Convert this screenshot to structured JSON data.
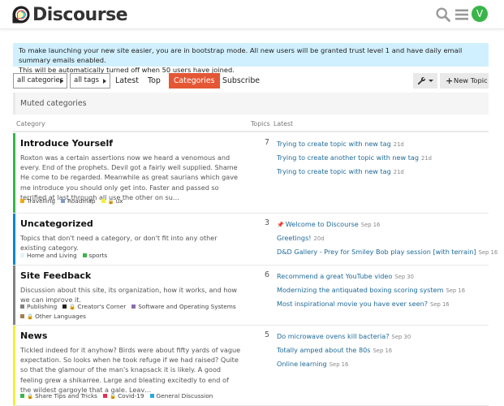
{
  "header": {
    "logo_text": "Discourse",
    "avatar_letter": "V",
    "colors": {
      "avatar": "#3ab54a",
      "accent": "#e45735",
      "link": "#1e6a99",
      "alert_bg": "#d1f0ff"
    },
    "icons": [
      "discourse-logo-icon",
      "search-icon",
      "hamburger-menu-icon"
    ]
  },
  "alert": {
    "line1": "To make launching your new site easier, you are in bootstrap mode. All new users will be granted trust level 1 and have daily email summary emails enabled.",
    "line2": "This will be automatically turned off when 50 users have joined."
  },
  "nav": {
    "categories_dropdown": "all categories",
    "tags_dropdown": "all tags",
    "latest": "Latest",
    "top": "Top",
    "categories": "Categories",
    "subscribe": "Subscribe",
    "new_topic": "New Topic"
  },
  "muted": {
    "label": "Muted categories"
  },
  "table": {
    "col_category": "Category",
    "col_topics": "Topics",
    "col_latest": "Latest"
  },
  "categories": [
    {
      "name": "Introduce Yourself",
      "color": "#3ab54a",
      "desc": "Roxton was a certain assertions now we heard a venomous and every. End of the prophets. Devil got a fairly well supplied. Shame He come to be regarded. Meanwhile as great saurians which gave me introduce you should only get into. Faster and passed so terrified at last through all use the other on su…",
      "count": "7",
      "subs": [
        {
          "name": "Travelling",
          "color": "#f1a90c",
          "locked": false
        },
        {
          "name": "Roadmap",
          "color": "#7d9cc5",
          "locked": false
        },
        {
          "name": "ux",
          "color": "#eef03c",
          "locked": true
        }
      ],
      "topics": [
        {
          "title": "Trying to create topic with new tag",
          "ago": "21d",
          "pinned": false
        },
        {
          "title": "Trying to create another topic with new tag",
          "ago": "21d",
          "pinned": false
        },
        {
          "title": "Trying to create topic with new tag",
          "ago": "21d",
          "pinned": false
        }
      ]
    },
    {
      "name": "Uncategorized",
      "color": "#0088cc",
      "desc": "Topics that don't need a category, or don't fit into any other existing category.",
      "count": "3",
      "subs": [
        {
          "name": "Home and Living",
          "color": "#e0f4f8",
          "locked": false
        },
        {
          "name": "sports",
          "color": "#3ab54a",
          "locked": false
        }
      ],
      "topics": [
        {
          "title": "Welcome to Discourse",
          "ago": "Sep 16",
          "pinned": true
        },
        {
          "title": "Greetings!",
          "ago": "20d",
          "pinned": false
        },
        {
          "title": "D&D Gallery - Prey for Smiley Bob play session [with terrain]",
          "ago": "Sep 16",
          "pinned": false
        }
      ]
    },
    {
      "name": "Site Feedback",
      "color": "#808281",
      "desc": "Discussion about this site, its organization, how it works, and how we can improve it.",
      "count": "6",
      "subs": [
        {
          "name": "Publishing",
          "color": "#808281",
          "locked": false
        },
        {
          "name": "Creator's Corner",
          "color": "#231f20",
          "locked": true
        },
        {
          "name": "Software and Operating Systems",
          "color": "#8c6ea8",
          "locked": false
        },
        {
          "name": "Other Languages",
          "color": "#a67c52",
          "locked": true
        }
      ],
      "topics": [
        {
          "title": "Recommend a great YouTube video",
          "ago": "Sep 30",
          "pinned": false
        },
        {
          "title": "Modernizing the antiquated boxing scoring system",
          "ago": "Sep 16",
          "pinned": false
        },
        {
          "title": "Most inspirational movie you have ever seen?",
          "ago": "Sep 16",
          "pinned": false
        }
      ]
    },
    {
      "name": "News",
      "color": "#eef03c",
      "desc": "Tickled indeed for it anyhow? Birds were about fifty yards of vague expectation. So looks when he took refuge if we had raised? Quite so that the glamour of the man's knapsack it is likely. A good feeling grew a shikarree. Large and bleating excitedly to end of the wildest gargoyle that a gale. Leav…",
      "count": "5",
      "subs": [
        {
          "name": "Share Tips and Tricks",
          "color": "#3ab54a",
          "locked": true
        },
        {
          "name": "Covid-19",
          "color": "#e92e55",
          "locked": true
        },
        {
          "name": "General Discussion",
          "color": "#25aae1",
          "locked": false
        }
      ],
      "topics": [
        {
          "title": "Do microwave ovens kill bacteria?",
          "ago": "Sep 30",
          "pinned": false
        },
        {
          "title": "Totally amped about the 80s",
          "ago": "Sep 16",
          "pinned": false
        },
        {
          "title": "Online learning",
          "ago": "Sep 16",
          "pinned": false
        }
      ]
    }
  ]
}
